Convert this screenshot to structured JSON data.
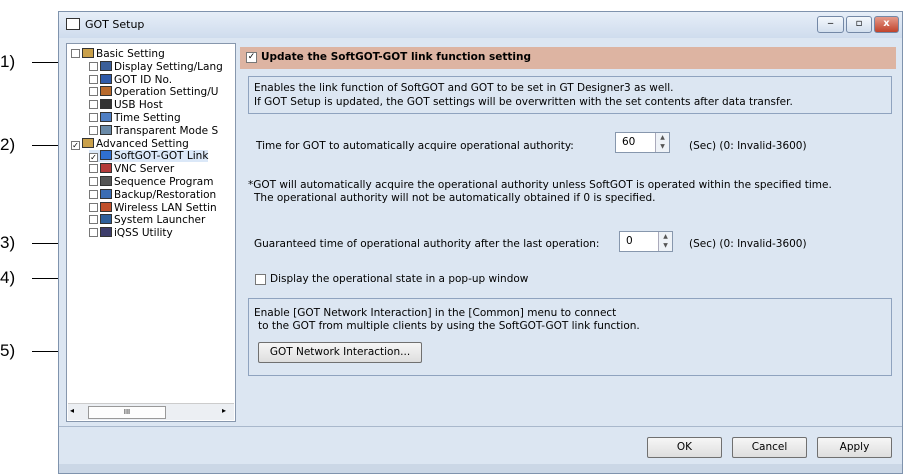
{
  "window": {
    "title": "GOT Setup",
    "controls": {
      "minimize": "‒",
      "maximize": "▫",
      "close": "x"
    }
  },
  "callouts": [
    "1)",
    "2)",
    "3)",
    "4)",
    "5)"
  ],
  "tree": {
    "items": [
      {
        "label": "Basic Setting",
        "level": 0,
        "checked": false,
        "icon": "folder-settings-icon"
      },
      {
        "label": "Display Setting/Lang",
        "level": 1,
        "checked": false,
        "icon": "display-icon"
      },
      {
        "label": "GOT ID No.",
        "level": 1,
        "checked": false,
        "icon": "id-icon"
      },
      {
        "label": "Operation Setting/U",
        "level": 1,
        "checked": false,
        "icon": "operation-icon"
      },
      {
        "label": "USB Host",
        "level": 1,
        "checked": false,
        "icon": "usb-icon"
      },
      {
        "label": "Time Setting",
        "level": 1,
        "checked": false,
        "icon": "clock-icon"
      },
      {
        "label": "Transparent Mode S",
        "level": 1,
        "checked": false,
        "icon": "transparent-icon"
      },
      {
        "label": "Advanced Setting",
        "level": 0,
        "checked": true,
        "icon": "folder-settings-icon"
      },
      {
        "label": "SoftGOT-GOT Link",
        "level": 1,
        "checked": true,
        "icon": "link-icon"
      },
      {
        "label": "VNC Server",
        "level": 1,
        "checked": false,
        "icon": "vnc-icon"
      },
      {
        "label": "Sequence Program",
        "level": 1,
        "checked": false,
        "icon": "program-icon"
      },
      {
        "label": "Backup/Restoration",
        "level": 1,
        "checked": false,
        "icon": "backup-icon"
      },
      {
        "label": "Wireless LAN Settin",
        "level": 1,
        "checked": false,
        "icon": "wireless-icon"
      },
      {
        "label": "System Launcher",
        "level": 1,
        "checked": false,
        "icon": "launcher-icon"
      },
      {
        "label": "iQSS Utility",
        "level": 1,
        "checked": false,
        "icon": "utility-icon"
      }
    ],
    "scroll_thumb": "III"
  },
  "panel": {
    "header_label": "Update the SoftGOT-GOT link function setting",
    "header_checked": true,
    "info_line1": "Enables the link function of SoftGOT and GOT to be set in GT Designer3 as well.",
    "info_line2": "If GOT Setup is updated, the GOT settings will be overwritten with the set contents after data transfer.",
    "acquire_label": "Time for GOT to automatically acquire operational authority:",
    "acquire_value": "60",
    "acquire_unit": "(Sec) (0: Invalid-3600)",
    "note_line1": "*GOT will automatically acquire the operational authority unless SoftGOT is operated within the specified time.",
    "note_line2": "The operational authority will not be automatically obtained if 0 is specified.",
    "guarantee_label": "Guaranteed time of operational authority after the last operation:",
    "guarantee_value": "0",
    "guarantee_unit": "(Sec) (0: Invalid-3600)",
    "popup_label": "Display the operational state in a pop-up window",
    "popup_checked": false,
    "network_line1": "Enable [GOT Network Interaction] in the [Common] menu to connect",
    "network_line2": "to the GOT from multiple clients by using the SoftGOT-GOT link function.",
    "network_button": "GOT Network Interaction..."
  },
  "footer": {
    "ok": "OK",
    "cancel": "Cancel",
    "apply": "Apply"
  }
}
